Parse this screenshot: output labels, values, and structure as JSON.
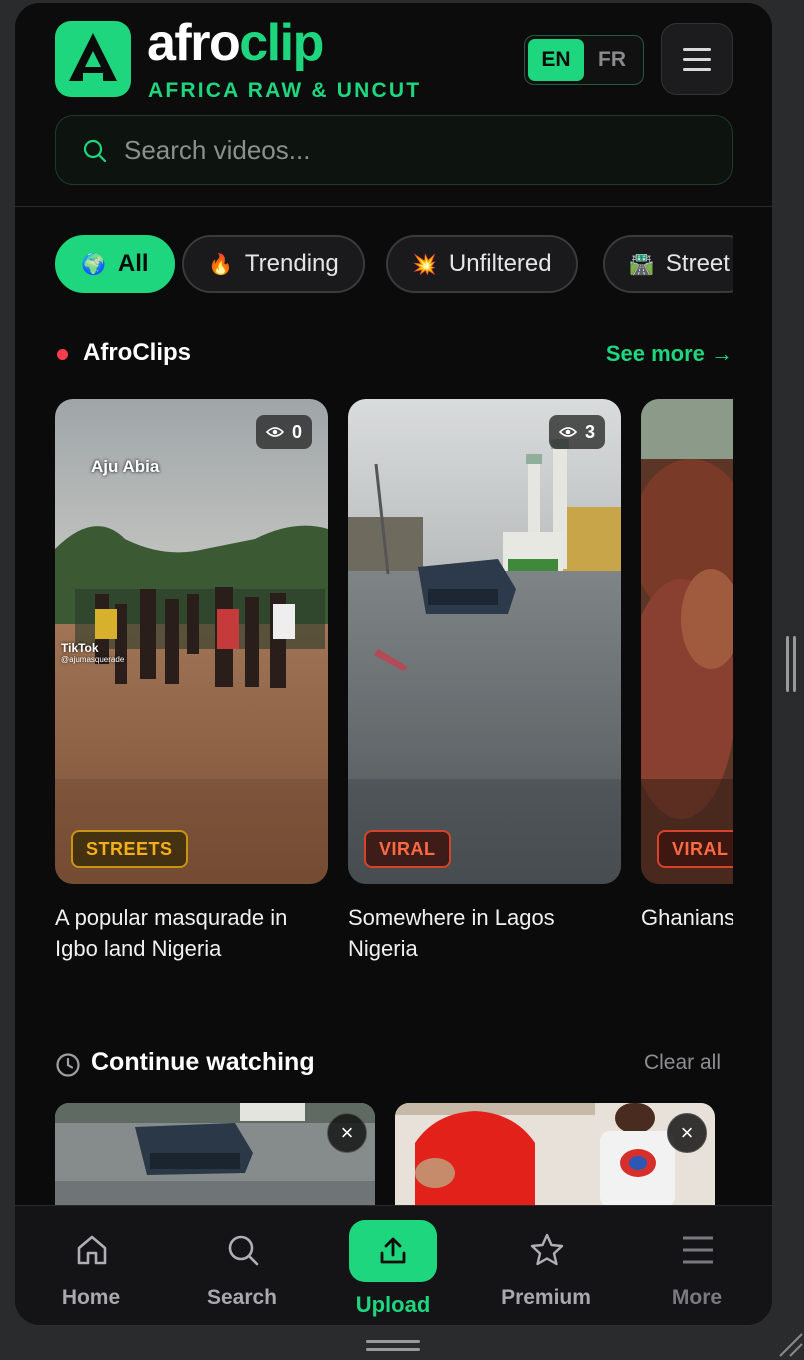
{
  "brand": {
    "name_part1": "afro",
    "name_part2": "clip",
    "tagline": "AFRICA RAW & UNCUT"
  },
  "language": {
    "active": "EN",
    "inactive": "FR"
  },
  "search": {
    "placeholder": "Search videos..."
  },
  "chips": [
    {
      "emoji": "🌍",
      "label": "All",
      "active": true
    },
    {
      "emoji": "🔥",
      "label": "Trending",
      "active": false
    },
    {
      "emoji": "💥",
      "label": "Unfiltered",
      "active": false
    },
    {
      "emoji": "🛣️",
      "label": "Street",
      "active": false
    }
  ],
  "afroclips": {
    "title": "AfroClips",
    "see_more": "See more →",
    "cards": [
      {
        "views": "0",
        "badge": "STREETS",
        "title": "A popular masqurade in Igbo land Nigeria",
        "overlay_top": "Aju Abia",
        "overlay_tiktok": "TikTok",
        "overlay_handle": "@ajumasquerade"
      },
      {
        "views": "3",
        "badge": "VIRAL",
        "title": "Somewhere in Lagos Nigeria"
      },
      {
        "views": "",
        "badge": "VIRAL",
        "title": "Ghanians mines th"
      }
    ]
  },
  "continue_watching": {
    "title": "Continue watching",
    "clear_all": "Clear all",
    "close_symbol": "×"
  },
  "nav": {
    "home": "Home",
    "search": "Search",
    "upload": "Upload",
    "premium": "Premium",
    "more": "More"
  },
  "colors": {
    "accent": "#1ed67e",
    "background": "#0b0b0c",
    "live_dot": "#ff3b4e",
    "streets_badge": "#f3b01a",
    "viral_badge": "#ff6a45"
  }
}
